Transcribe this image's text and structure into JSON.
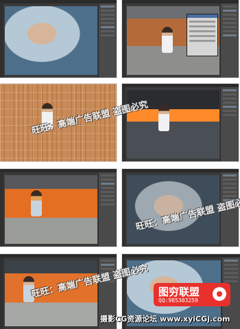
{
  "panels": [
    {
      "id": "p1",
      "scene": "hood-closeup"
    },
    {
      "id": "p2",
      "scene": "bench-with-dialog"
    },
    {
      "id": "p3",
      "scene": "bench-grid"
    },
    {
      "id": "p4",
      "scene": "bench-sunset"
    },
    {
      "id": "p5",
      "scene": "bench-orange"
    },
    {
      "id": "p6",
      "scene": "hood-closeup-grey"
    },
    {
      "id": "p7",
      "scene": "bench-orange-2"
    },
    {
      "id": "p8",
      "scene": "hood-closeup-blue"
    }
  ],
  "watermarks": [
    {
      "text": "旺旺：高端广告联盟 盗图必究"
    },
    {
      "text": "旺旺：高端广告联盟 盗图必究"
    },
    {
      "text": "旺旺：高端广告联盟 盗图必究"
    }
  ],
  "bottom_caption": "摄影CG资源论坛 www.xyiCGj.com",
  "logo": {
    "title": "图穷联盟",
    "qq": "QQ:985303259"
  },
  "colors": {
    "logo_red": "#e8312c",
    "ps_dark": "#3a3a3a",
    "panel_grey": "#4a4a4a"
  }
}
